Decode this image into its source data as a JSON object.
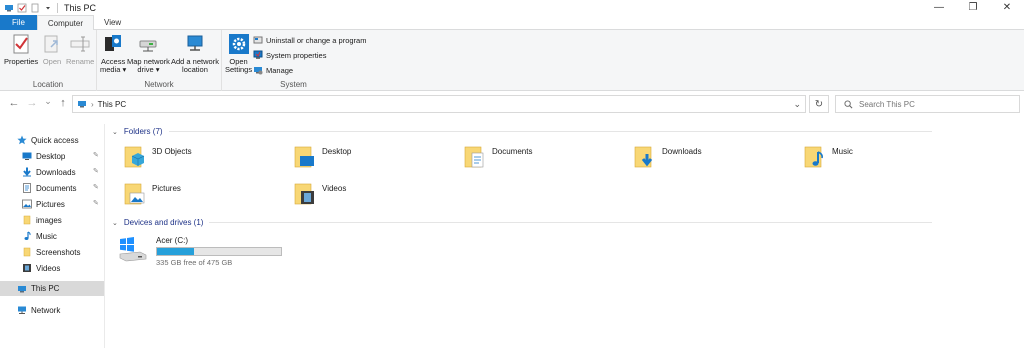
{
  "window": {
    "title": "This PC",
    "minimize": "—",
    "maximize": "❐",
    "close": "✕"
  },
  "tabs": [
    {
      "label": "File"
    },
    {
      "label": "Computer"
    },
    {
      "label": "View"
    }
  ],
  "ribbon": {
    "location": {
      "label": "Location",
      "properties": "Properties",
      "open": "Open",
      "rename": "Rename"
    },
    "network": {
      "label": "Network",
      "access_media_1": "Access",
      "access_media_2": "media ▾",
      "map_drive_1": "Map network",
      "map_drive_2": "drive ▾",
      "add_location_1": "Add a network",
      "add_location_2": "location"
    },
    "system": {
      "label": "System",
      "open_settings_1": "Open",
      "open_settings_2": "Settings",
      "uninstall": "Uninstall or change a program",
      "system_properties": "System properties",
      "manage": "Manage"
    }
  },
  "address": {
    "back": "←",
    "forward": "→",
    "recent": "⌄",
    "up": "↑",
    "crumb_sep": "›",
    "path": "This PC",
    "dropdown": "⌄",
    "refresh": "↻",
    "search_placeholder": "Search This PC"
  },
  "navpane": {
    "quick_access": "Quick access",
    "items": [
      {
        "label": "Desktop",
        "pinned": true
      },
      {
        "label": "Downloads",
        "pinned": true
      },
      {
        "label": "Documents",
        "pinned": true
      },
      {
        "label": "Pictures",
        "pinned": true
      },
      {
        "label": "images",
        "pinned": false
      },
      {
        "label": "Music",
        "pinned": false
      },
      {
        "label": "Screenshots",
        "pinned": false
      },
      {
        "label": "Videos",
        "pinned": false
      }
    ],
    "this_pc": "This PC",
    "network": "Network"
  },
  "content": {
    "folders_header": "Folders (7)",
    "folders": [
      {
        "name": "3D Objects"
      },
      {
        "name": "Desktop"
      },
      {
        "name": "Documents"
      },
      {
        "name": "Downloads"
      },
      {
        "name": "Music"
      },
      {
        "name": "Pictures"
      },
      {
        "name": "Videos"
      }
    ],
    "devices_header": "Devices and drives (1)",
    "drive": {
      "name": "Acer (C:)",
      "free_text": "335 GB free of 475 GB",
      "used_fraction": 0.295
    }
  },
  "colors": {
    "accent": "#1979ca",
    "folder": "#f8d775",
    "bar_fill": "#26a0da"
  }
}
